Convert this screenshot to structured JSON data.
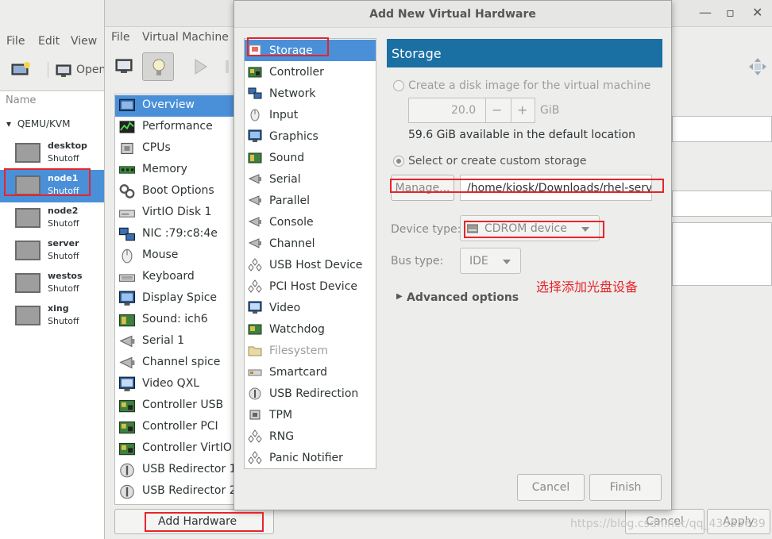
{
  "main_window": {
    "menu": [
      "File",
      "Edit",
      "View"
    ],
    "toolbar_open_label": "Open",
    "list_header": "Name",
    "group": "QEMU/KVM",
    "vms": [
      {
        "name": "desktop",
        "state": "Shutoff"
      },
      {
        "name": "node1",
        "state": "Shutoff",
        "selected": true
      },
      {
        "name": "node2",
        "state": "Shutoff"
      },
      {
        "name": "server",
        "state": "Shutoff"
      },
      {
        "name": "westos",
        "state": "Shutoff"
      },
      {
        "name": "xing",
        "state": "Shutoff"
      }
    ]
  },
  "details_window": {
    "menu": [
      "File",
      "Virtual Machine"
    ],
    "hardware": [
      {
        "label": "Overview",
        "icon": "overview-icon",
        "selected": true
      },
      {
        "label": "Performance",
        "icon": "performance-icon"
      },
      {
        "label": "CPUs",
        "icon": "cpu-icon"
      },
      {
        "label": "Memory",
        "icon": "memory-icon"
      },
      {
        "label": "Boot Options",
        "icon": "boot-options-icon"
      },
      {
        "label": "VirtIO Disk 1",
        "icon": "disk-icon"
      },
      {
        "label": "NIC :79:c8:4e",
        "icon": "nic-icon"
      },
      {
        "label": "Mouse",
        "icon": "mouse-icon"
      },
      {
        "label": "Keyboard",
        "icon": "keyboard-icon"
      },
      {
        "label": "Display Spice",
        "icon": "display-icon"
      },
      {
        "label": "Sound: ich6",
        "icon": "sound-icon"
      },
      {
        "label": "Serial 1",
        "icon": "serial-icon"
      },
      {
        "label": "Channel spice",
        "icon": "channel-icon"
      },
      {
        "label": "Video QXL",
        "icon": "video-icon"
      },
      {
        "label": "Controller USB",
        "icon": "controller-icon"
      },
      {
        "label": "Controller PCI",
        "icon": "controller-icon"
      },
      {
        "label": "Controller VirtIO S",
        "icon": "controller-icon"
      },
      {
        "label": "USB Redirector 1",
        "icon": "usb-redirector-icon"
      },
      {
        "label": "USB Redirector 2",
        "icon": "usb-redirector-icon"
      }
    ],
    "add_hardware_label": "Add Hardware",
    "cancel_label": "Cancel",
    "apply_label": "Apply"
  },
  "dialog": {
    "title": "Add New Virtual Hardware",
    "device_list": [
      {
        "label": "Storage",
        "icon": "storage-icon",
        "selected": true
      },
      {
        "label": "Controller",
        "icon": "controller-icon"
      },
      {
        "label": "Network",
        "icon": "network-icon"
      },
      {
        "label": "Input",
        "icon": "mouse-icon"
      },
      {
        "label": "Graphics",
        "icon": "display-icon"
      },
      {
        "label": "Sound",
        "icon": "sound-icon"
      },
      {
        "label": "Serial",
        "icon": "serial-icon"
      },
      {
        "label": "Parallel",
        "icon": "parallel-icon"
      },
      {
        "label": "Console",
        "icon": "console-icon"
      },
      {
        "label": "Channel",
        "icon": "channel-icon"
      },
      {
        "label": "USB Host Device",
        "icon": "usb-icon"
      },
      {
        "label": "PCI Host Device",
        "icon": "pci-icon"
      },
      {
        "label": "Video",
        "icon": "video-icon"
      },
      {
        "label": "Watchdog",
        "icon": "watchdog-icon"
      },
      {
        "label": "Filesystem",
        "icon": "folder-icon",
        "disabled": true
      },
      {
        "label": "Smartcard",
        "icon": "smartcard-icon"
      },
      {
        "label": "USB Redirection",
        "icon": "usb-redirector-icon"
      },
      {
        "label": "TPM",
        "icon": "tpm-icon"
      },
      {
        "label": "RNG",
        "icon": "rng-icon"
      },
      {
        "label": "Panic Notifier",
        "icon": "panic-icon"
      }
    ],
    "storage": {
      "header": "Storage",
      "create_disk_label": "Create a disk image for the virtual machine",
      "size_value": "20.0",
      "size_unit": "GiB",
      "available_text": "59.6 GiB available in the default location",
      "custom_storage_label": "Select or create custom storage",
      "manage_label": "Manage...",
      "path_value": "/home/kiosk/Downloads/rhel-serve",
      "device_type_label": "Device type:",
      "device_type_value": "CDROM device",
      "bus_type_label": "Bus type:",
      "bus_type_value": "IDE",
      "advanced_label": "Advanced options"
    },
    "cancel_label": "Cancel",
    "finish_label": "Finish"
  },
  "annotation": "选择添加光盘设备",
  "watermark": "https://blog.csdn.net/qq_43355639",
  "colors": {
    "selection": "#4a90d9",
    "header_blue": "#1a6fa3",
    "annotation_red": "#e8242a"
  }
}
